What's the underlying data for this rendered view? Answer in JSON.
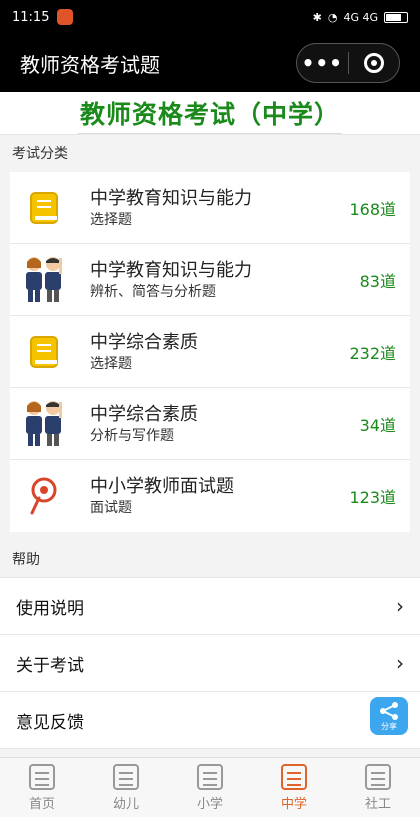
{
  "status": {
    "time": "11:15",
    "network": "4G 4G"
  },
  "titlebar": {
    "title": "教师资格考试题",
    "more": "•••"
  },
  "header": {
    "title": "教师资格考试（中学）"
  },
  "sections": {
    "categories": "考试分类",
    "help": "帮助"
  },
  "categories": [
    {
      "icon": "yellow-book-icon",
      "title": "中学教育知识与能力",
      "sub": "选择题",
      "count": "168道"
    },
    {
      "icon": "students-icon",
      "title": "中学教育知识与能力",
      "sub": "辨析、简答与分析题",
      "count": "83道"
    },
    {
      "icon": "yellow-book-icon",
      "title": "中学综合素质",
      "sub": "选择题",
      "count": "232道"
    },
    {
      "icon": "students-icon",
      "title": "中学综合素质",
      "sub": "分析与写作题",
      "count": "34道"
    },
    {
      "icon": "pin-icon",
      "title": "中小学教师面试题",
      "sub": "面试题",
      "count": "123道"
    }
  ],
  "help_items": [
    {
      "label": "使用说明"
    },
    {
      "label": "关于考试"
    },
    {
      "label": "意见反馈"
    }
  ],
  "share": {
    "label": "分享"
  },
  "tabs": [
    {
      "label": "首页",
      "active": false
    },
    {
      "label": "幼儿",
      "active": false
    },
    {
      "label": "小学",
      "active": false
    },
    {
      "label": "中学",
      "active": true
    },
    {
      "label": "社工",
      "active": false
    }
  ],
  "colors": {
    "green": "#1a8a1a",
    "accent": "#e0642a",
    "share": "#3ca7ee"
  }
}
